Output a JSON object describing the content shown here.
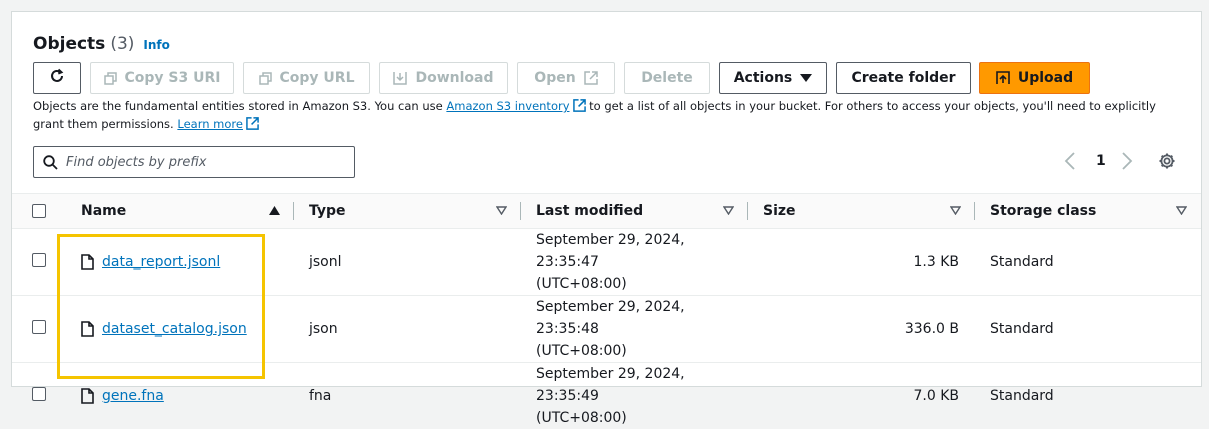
{
  "header": {
    "title": "Objects",
    "count": "(3)",
    "info": "Info"
  },
  "toolbar": {
    "refresh_icon": "refresh-icon",
    "copy_s3_uri": "Copy S3 URI",
    "copy_url": "Copy URL",
    "download": "Download",
    "open": "Open",
    "delete": "Delete",
    "actions": "Actions",
    "create_folder": "Create folder",
    "upload": "Upload"
  },
  "description": {
    "text1": "Objects are the fundamental entities stored in Amazon S3. You can use ",
    "link1": "Amazon S3 inventory",
    "text2": " to get a list of all objects in your bucket. For others to access your objects, you'll need to explicitly grant them permissions. ",
    "link2": "Learn more"
  },
  "search": {
    "placeholder": "Find objects by prefix"
  },
  "pagination": {
    "page": "1"
  },
  "table": {
    "columns": [
      "Name",
      "Type",
      "Last modified",
      "Size",
      "Storage class"
    ],
    "rows": [
      {
        "name": "data_report.jsonl",
        "type": "jsonl",
        "modified_date": "September 29, 2024, 23:35:47",
        "modified_tz": "(UTC+08:00)",
        "size": "1.3 KB",
        "storage": "Standard"
      },
      {
        "name": "dataset_catalog.json",
        "type": "json",
        "modified_date": "September 29, 2024, 23:35:48",
        "modified_tz": "(UTC+08:00)",
        "size": "336.0 B",
        "storage": "Standard"
      },
      {
        "name": "gene.fna",
        "type": "fna",
        "modified_date": "September 29, 2024, 23:35:49",
        "modified_tz": "(UTC+08:00)",
        "size": "7.0 KB",
        "storage": "Standard"
      }
    ]
  },
  "colors": {
    "accent": "#ff9900",
    "link": "#0073bb",
    "highlight": "#f5c400"
  }
}
